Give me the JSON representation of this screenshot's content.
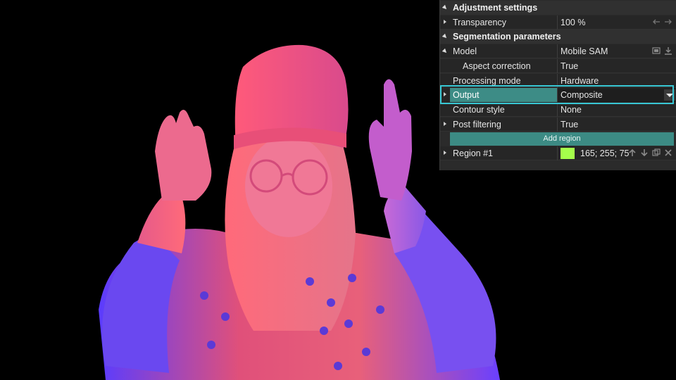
{
  "panel": {
    "categories": {
      "adjustment": "Adjustment settings",
      "segmentation": "Segmentation parameters"
    },
    "transparency": {
      "name": "Transparency",
      "value": "100 %"
    },
    "model": {
      "name": "Model",
      "value": "Mobile SAM"
    },
    "aspect_correction": {
      "name": "Aspect correction",
      "value": "True"
    },
    "processing_mode": {
      "name": "Processing mode",
      "value": "Hardware"
    },
    "output": {
      "name": "Output",
      "value": "Composite"
    },
    "contour_style": {
      "name": "Contour style",
      "value": "None"
    },
    "post_filtering": {
      "name": "Post filtering",
      "value": "True"
    },
    "add_region_label": "Add region",
    "region": {
      "name": "Region #1",
      "color": "#a5ff4b",
      "value": "165; 255; 75"
    }
  },
  "colors": {
    "accent": "#3d8c86",
    "highlight": "#38c7d4"
  }
}
